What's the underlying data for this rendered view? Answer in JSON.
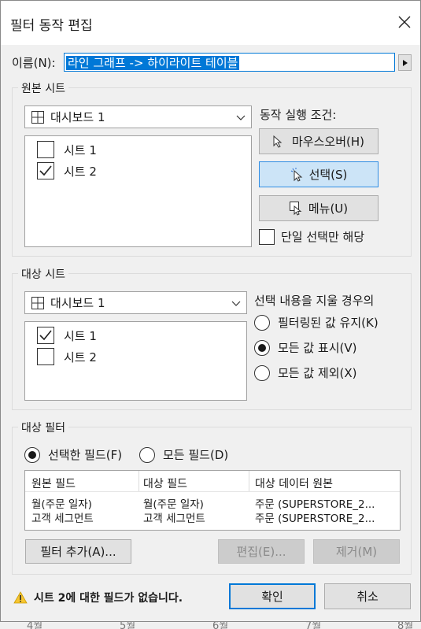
{
  "window": {
    "title": "필터 동작 편집"
  },
  "name_field": {
    "label": "이름(N):",
    "value": "라인 그래프 -> 하이라이트 테이블"
  },
  "source": {
    "group_label": "원본 시트",
    "dashboard": "대시보드 1",
    "sheets": [
      {
        "label": "시트 1",
        "checked": false
      },
      {
        "label": "시트 2",
        "checked": true
      }
    ]
  },
  "run_condition": {
    "label": "동작 실행 조건:",
    "hover": "마우스오버(H)",
    "select": "선택(S)",
    "menu": "메뉴(U)",
    "single_select": "단일 선택만 해당"
  },
  "target": {
    "group_label": "대상 시트",
    "dashboard": "대시보드 1",
    "sheets": [
      {
        "label": "시트 1",
        "checked": true
      },
      {
        "label": "시트 2",
        "checked": false
      }
    ]
  },
  "clear_selection": {
    "label": "선택 내용을 지울 경우의",
    "keep": "필터링된 값 유지(K)",
    "show_all": "모든 값 표시(V)",
    "exclude_all": "모든 값 제외(X)",
    "selected": "show_all"
  },
  "target_filters": {
    "group_label": "대상 필터",
    "selected_fields": "선택한 필드(F)",
    "all_fields": "모든 필드(D)",
    "columns": [
      "원본 필드",
      "대상 필드",
      "대상 데이터 원본"
    ],
    "rows": [
      [
        "월(주문 일자)",
        "월(주문 일자)",
        "주문 (SUPERSTORE_2..."
      ],
      [
        "고객 세그먼트",
        "고객 세그먼트",
        "주문 (SUPERSTORE_2..."
      ]
    ],
    "add": "필터 추가(A)...",
    "edit": "편집(E)...",
    "remove": "제거(M)"
  },
  "footer": {
    "warning": "시트 2에 대한 필드가 없습니다.",
    "ok": "확인",
    "cancel": "취소"
  },
  "background_axis": [
    "4월",
    "5월",
    "6월",
    "7월",
    "8월"
  ],
  "colors": {
    "accent": "#0078d7",
    "selection": "#0078d7",
    "warning": "#f7c631"
  }
}
